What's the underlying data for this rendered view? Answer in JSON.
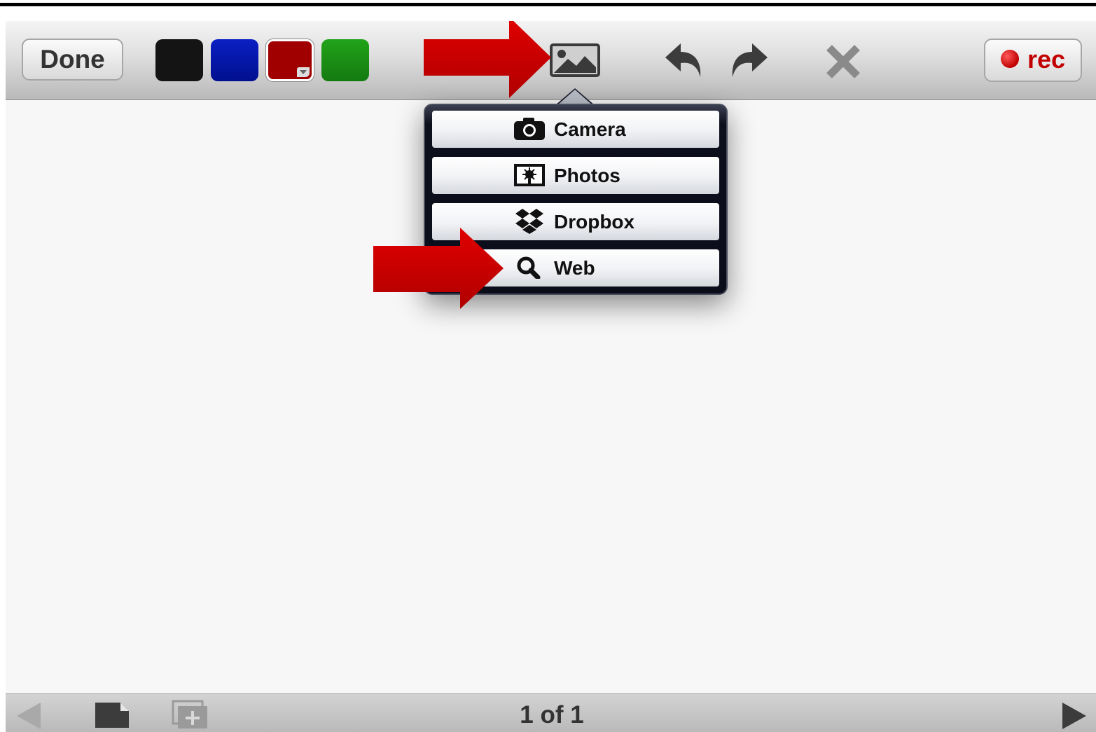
{
  "toolbar": {
    "done_label": "Done",
    "colors": [
      "#141414",
      "#0b1fc4",
      "#a00000",
      "#22a31a"
    ],
    "selected_color": "#a00000",
    "icons": [
      "image-icon",
      "undo-icon",
      "redo-icon",
      "clear-icon"
    ],
    "rec_label": "rec"
  },
  "image_menu": {
    "items": [
      {
        "label": "Camera",
        "icon": "camera-icon"
      },
      {
        "label": "Photos",
        "icon": "photos-icon"
      },
      {
        "label": "Dropbox",
        "icon": "dropbox-icon"
      },
      {
        "label": "Web",
        "icon": "search-icon"
      }
    ]
  },
  "annotations": {
    "arrow_color": "#d10000",
    "targets": [
      "image-icon",
      "Web"
    ]
  },
  "bottombar": {
    "page_indicator": "1 of 1",
    "icons": [
      "prev-page-icon",
      "page-icon",
      "add-page-icon",
      "next-page-icon"
    ]
  }
}
